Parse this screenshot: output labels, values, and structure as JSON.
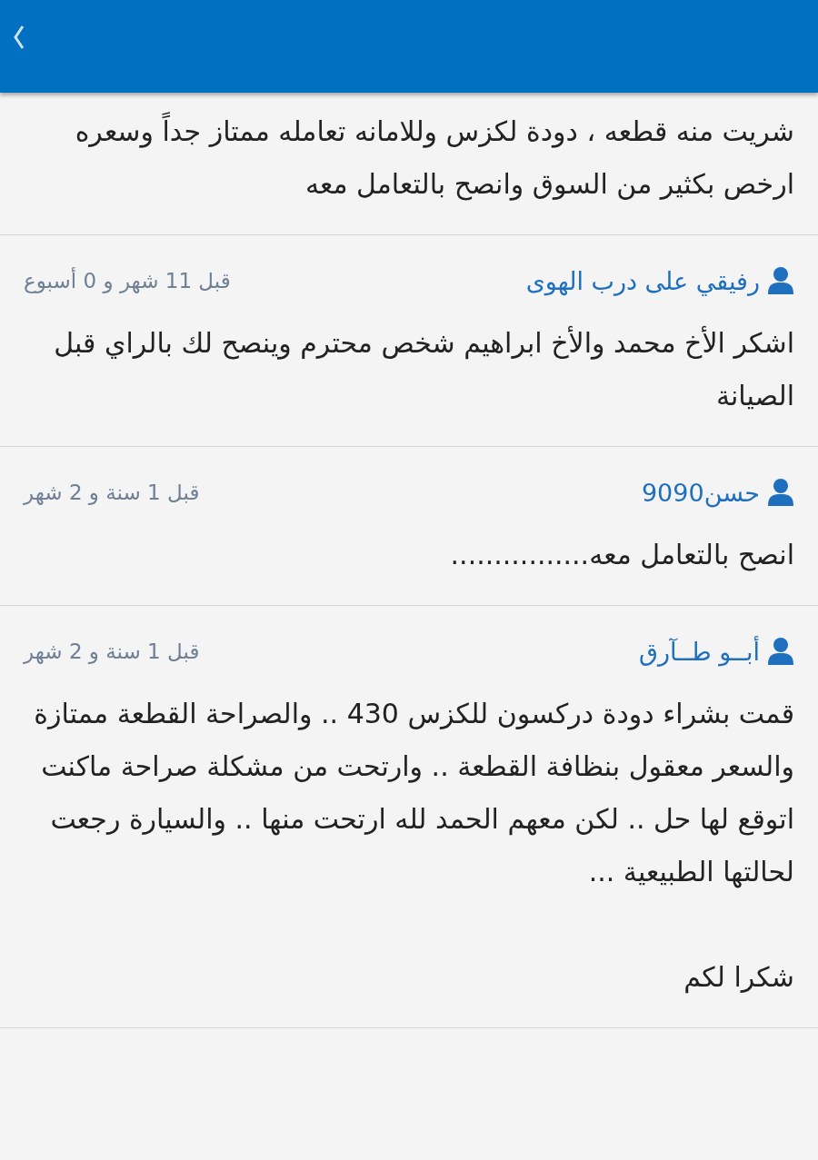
{
  "header": {
    "back_button": true
  },
  "partial_comment": {
    "body": [
      "شريت منه قطعه ، دودة لكزس وللامانه تعامله ممتاز جداً وسعره ارخص بكثير من السوق وانصح بالتعامل معه"
    ]
  },
  "comments": [
    {
      "author": "رفيقي على درب الهوى",
      "time": "قبل 11 شهر و 0 أسبوع",
      "body": [
        "اشكر الأخ محمد والأخ ابراهيم شخص محترم وينصح  لك بالراي قبل الصيانة"
      ]
    },
    {
      "author": "حسن9090",
      "time": "قبل 1 سنة و 2 شهر",
      "body": [
        "انصح بالتعامل معه................"
      ]
    },
    {
      "author": "أبــو طــآرق",
      "time": "قبل 1 سنة و 2 شهر",
      "body": [
        "قمت بشراء دودة دركسون للكزس 430 .. والصراحة القطعة ممتازة والسعر معقول بنظافة القطعة .. وارتحت من مشكلة صراحة ماكنت اتوقع لها حل .. لكن معهم الحمد لله ارتحت منها .. والسيارة رجعت لحالتها الطبيعية ...",
        "شكرا لكم"
      ]
    }
  ]
}
